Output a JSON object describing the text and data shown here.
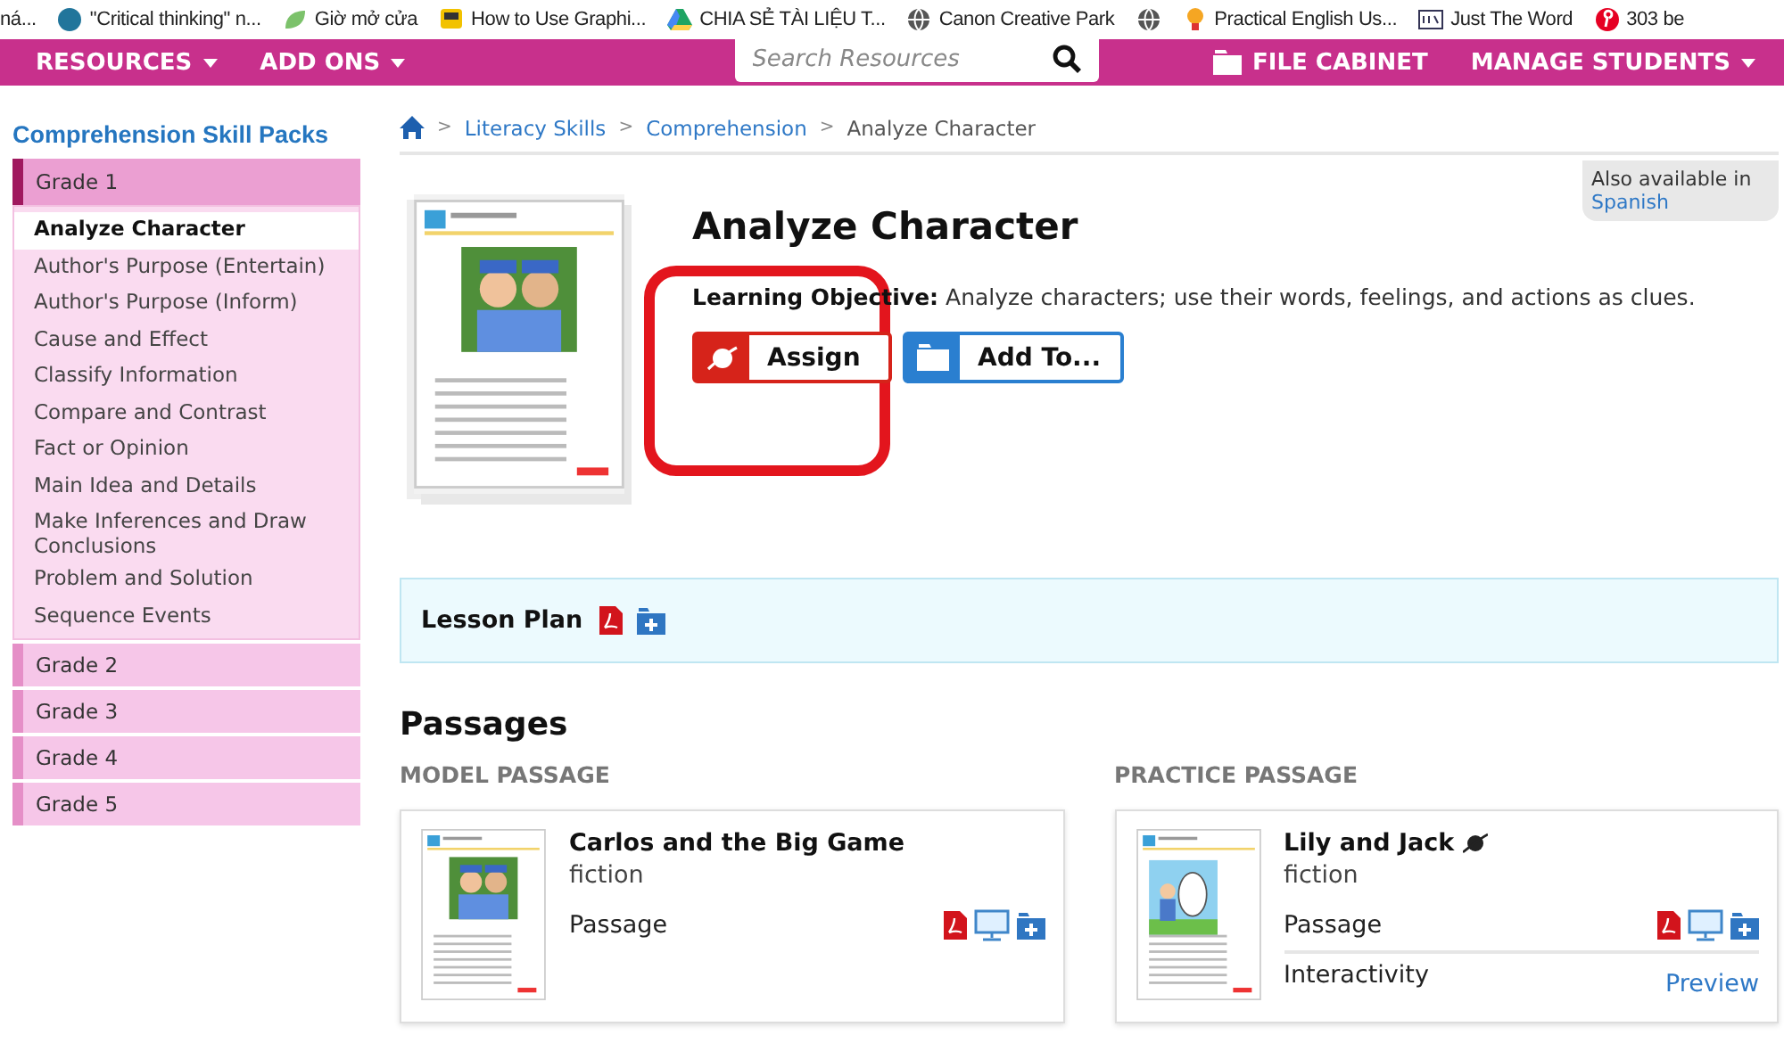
{
  "bookmarks": [
    {
      "kind": "link",
      "label": "ná..."
    },
    {
      "kind": "link",
      "label": "\"Critical thinking\" n..."
    },
    {
      "kind": "link",
      "label": "Giờ mở cửa"
    },
    {
      "kind": "link",
      "label": "How to Use Graphi..."
    },
    {
      "kind": "link",
      "label": "CHIA SẺ TÀI LIỆU T..."
    },
    {
      "kind": "link",
      "label": "Canon Creative Park"
    },
    {
      "kind": "icon"
    },
    {
      "kind": "link",
      "label": "Practical English Us..."
    },
    {
      "kind": "link",
      "label": "Just The Word"
    },
    {
      "kind": "link",
      "label": "303 be"
    }
  ],
  "nav": {
    "menus": [
      {
        "label": "RESOURCES"
      },
      {
        "label": "ADD ONS"
      }
    ],
    "search": {
      "placeholder": "Search Resources"
    },
    "file_cabinet": {
      "label": "FILE CABINET"
    },
    "manage": {
      "label": "MANAGE STUDENTS"
    }
  },
  "sidebar": {
    "title": "Comprehension Skill Packs",
    "grades": [
      {
        "label": "Grade 1",
        "expanded": true,
        "children": [
          {
            "label": "Analyze Character",
            "selected": true
          },
          {
            "label": "Author's Purpose (Entertain)",
            "selected": false
          },
          {
            "label": "Author's Purpose (Inform)",
            "selected": false
          },
          {
            "label": "Cause and Effect",
            "selected": false
          },
          {
            "label": "Classify Information",
            "selected": false
          },
          {
            "label": "Compare and Contrast",
            "selected": false
          },
          {
            "label": "Fact or Opinion",
            "selected": false
          },
          {
            "label": "Main Idea and Details",
            "selected": false
          },
          {
            "label": "Make Inferences and Draw Conclusions",
            "selected": false
          },
          {
            "label": "Problem and Solution",
            "selected": false
          },
          {
            "label": "Sequence Events",
            "selected": false
          }
        ]
      },
      {
        "label": "Grade 2",
        "expanded": false
      },
      {
        "label": "Grade 3",
        "expanded": false
      },
      {
        "label": "Grade 4",
        "expanded": false
      },
      {
        "label": "Grade 5",
        "expanded": false
      }
    ]
  },
  "breadcrumb": [
    {
      "separator": ">",
      "label": "Literacy Skills",
      "current": false
    },
    {
      "separator": ">",
      "label": "Comprehension",
      "current": false
    },
    {
      "separator": ">",
      "label": "Analyze Character",
      "current": true
    }
  ],
  "resource": {
    "title": "Analyze Character",
    "objective": "**Learning Objective:** Analyze characters; use their words, feelings, and actions as clues.",
    "buttons": [
      {
        "label": "Assign",
        "kind": "assign"
      },
      {
        "label": "Add To...",
        "kind": "add"
      }
    ],
    "also_available": {
      "text": "Also available in",
      "link": "Spanish"
    }
  },
  "lesson_plan": {
    "label": "Lesson Plan"
  },
  "passages": {
    "title": "Passages",
    "columns": [
      {
        "heading": "MODEL PASSAGE",
        "card": {
          "title": "Carlos and the Big Game",
          "assignable": false,
          "genre": "fiction",
          "rows": [
            {
              "label": "Passage",
              "kind": "files"
            }
          ]
        }
      },
      {
        "heading": "PRACTICE PASSAGE",
        "card": {
          "title": "Lily and Jack",
          "assignable": true,
          "genre": "fiction",
          "rows": [
            {
              "label": "Passage",
              "kind": "files"
            },
            {
              "label": "Interactivity",
              "kind": "link",
              "link": "Preview"
            }
          ]
        }
      }
    ]
  }
}
